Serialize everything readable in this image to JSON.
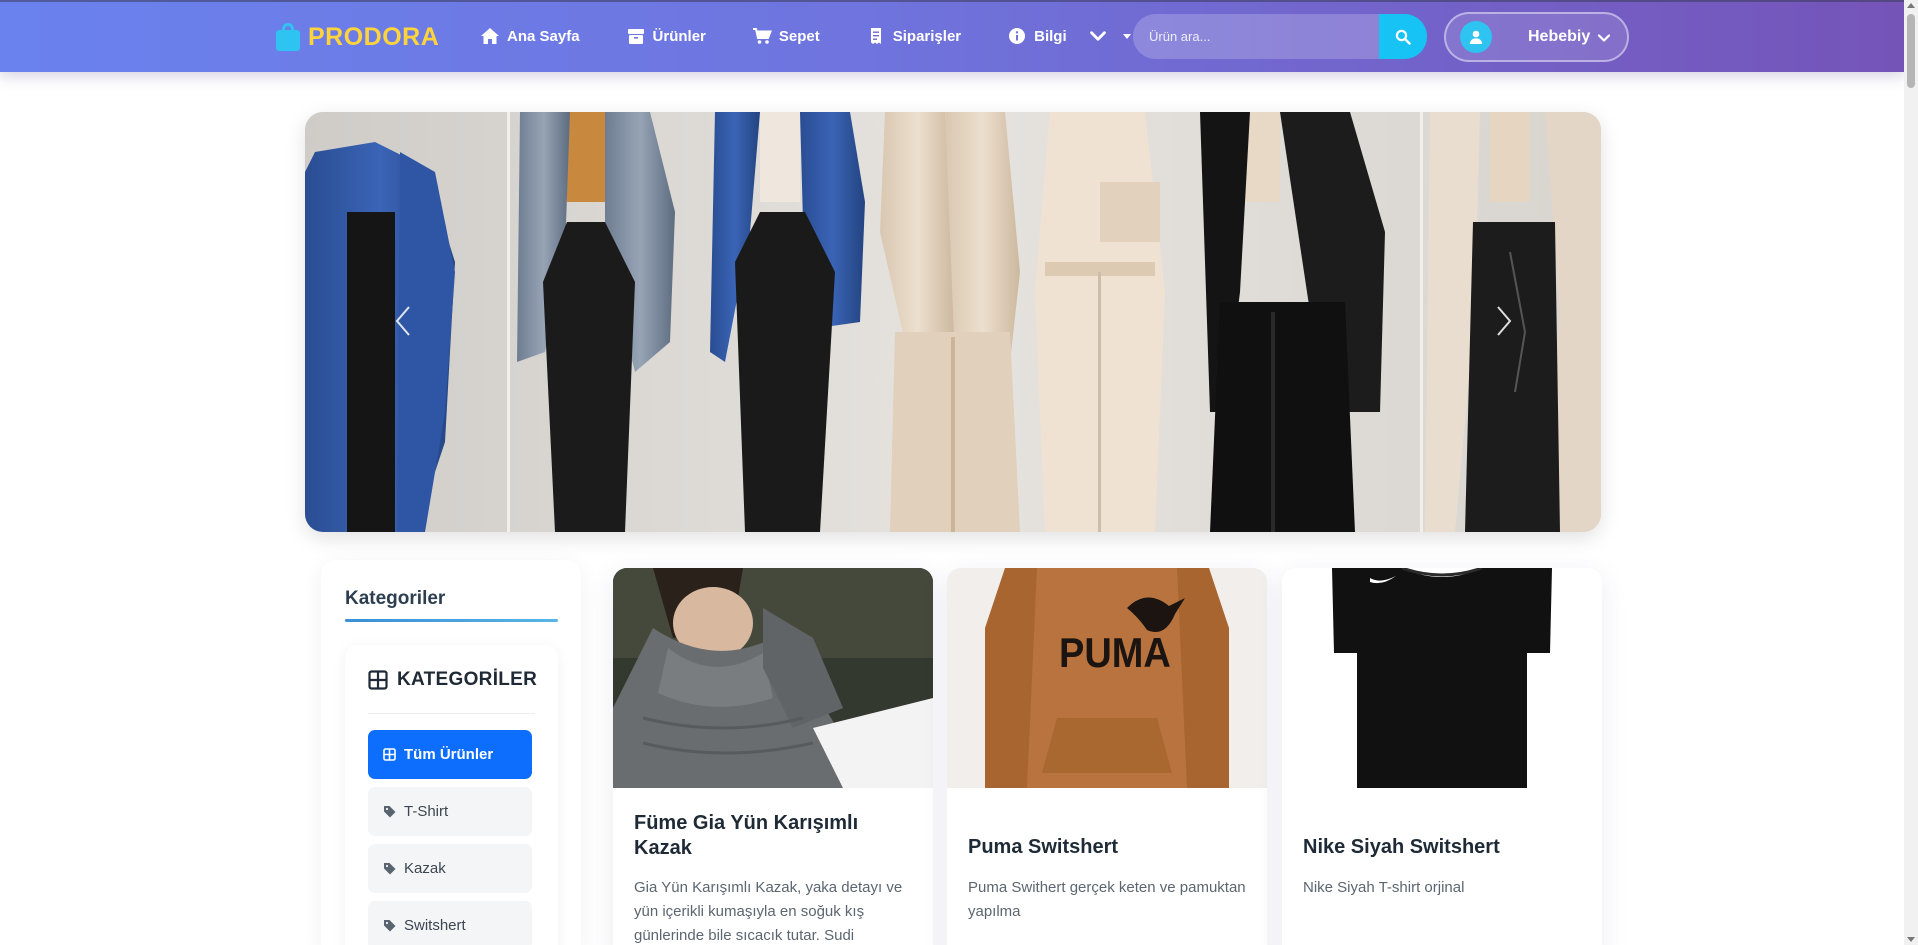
{
  "brand": {
    "name": "PRODORA",
    "icon": "shopping-bag-icon",
    "color": "#ffd43b"
  },
  "nav": {
    "items": [
      {
        "label": "Ana Sayfa",
        "icon": "home-icon"
      },
      {
        "label": "Ürünler",
        "icon": "box-icon"
      },
      {
        "label": "Sepet",
        "icon": "cart-icon"
      },
      {
        "label": "Siparişler",
        "icon": "receipt-icon"
      },
      {
        "label": "Bilgi",
        "icon": "info-icon"
      }
    ]
  },
  "search": {
    "placeholder": "Ürün ara...",
    "button_icon": "search-icon",
    "button_color": "#17c3f5"
  },
  "user": {
    "name": "Hebebiy",
    "icon": "user-icon"
  },
  "hero": {
    "prev_icon": "chevron-left-icon",
    "next_icon": "chevron-right-icon"
  },
  "sidebar": {
    "title": "Kategoriler",
    "card_title": "KATEGORİLER",
    "items": [
      {
        "label": "Tüm Ürünler",
        "icon": "grid-icon",
        "active": true
      },
      {
        "label": "T-Shirt",
        "icon": "tag-icon"
      },
      {
        "label": "Kazak",
        "icon": "tag-icon"
      },
      {
        "label": "Switshert",
        "icon": "tag-icon"
      }
    ],
    "accent": "#0d6efd"
  },
  "products": [
    {
      "title": "Füme Gia Yün Karışımlı Kazak",
      "description": "Gia Yün Karışımlı Kazak, yaka detayı ve yün içerikli kumaşıyla en soğuk kış günlerinde bile sıcacık tutar. Sudi"
    },
    {
      "title": "Puma Switshert",
      "description": "Puma Swithert gerçek keten ve pamuktan yapılma"
    },
    {
      "title": "Nike Siyah Switshert",
      "description": "Nike Siyah T-shirt orjinal"
    }
  ]
}
